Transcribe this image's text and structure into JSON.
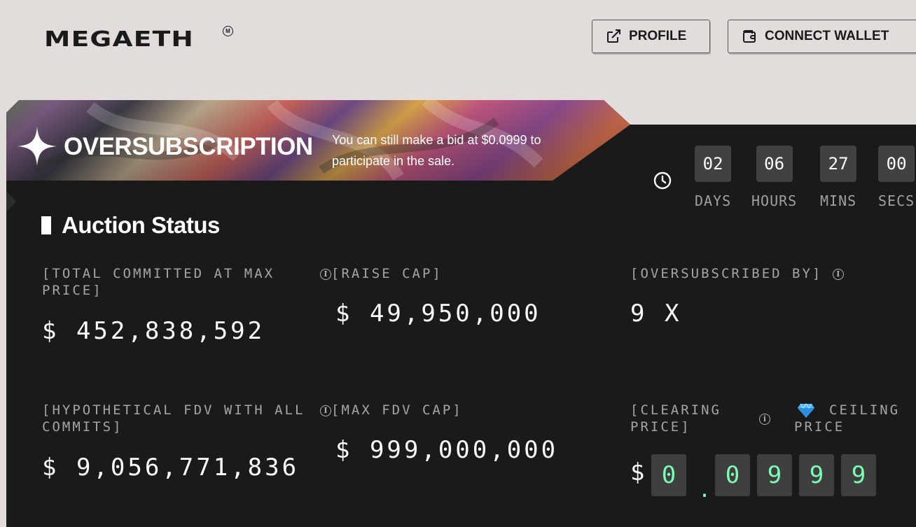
{
  "header": {
    "logo": "MEGAETH",
    "logo_mark": "M",
    "profile_label": "PROFILE",
    "wallet_label": "CONNECT WALLET"
  },
  "banner": {
    "title": "OVERSUBSCRIPTION",
    "subtitle": "You can still make a bid at $0.0999 to participate in the sale."
  },
  "countdown": [
    {
      "value": "02",
      "label": "DAYS"
    },
    {
      "value": "06",
      "label": "HOURS"
    },
    {
      "value": "27",
      "label": "MINS"
    },
    {
      "value": "00",
      "label": "SECS"
    }
  ],
  "auction": {
    "title": "Auction Status",
    "total_committed_label": "[TOTAL COMMITTED AT MAX PRICE]",
    "total_committed_value": "$ 452,838,592",
    "raise_cap_label": "[RAISE CAP]",
    "raise_cap_value": "$ 49,950,000",
    "oversubscribed_label": "[OVERSUBSCRIBED BY]",
    "oversubscribed_value": "9 X",
    "fdv_label": "[HYPOTHETICAL FDV WITH ALL COMMITS]",
    "fdv_value": "$ 9,056,771,836",
    "max_fdv_label": "[MAX FDV CAP]",
    "max_fdv_value": "$ 999,000,000",
    "clearing_price_label": "[CLEARING PRICE]",
    "ceiling_price_label": "CEILING PRICE",
    "price_currency": "$",
    "price_digits": [
      "0",
      ".",
      "0",
      "9",
      "9",
      "9"
    ]
  },
  "colors": {
    "page_bg": "#e2dcdb",
    "card_bg": "#1a1a1a",
    "digit_accent": "#7cffb4"
  }
}
